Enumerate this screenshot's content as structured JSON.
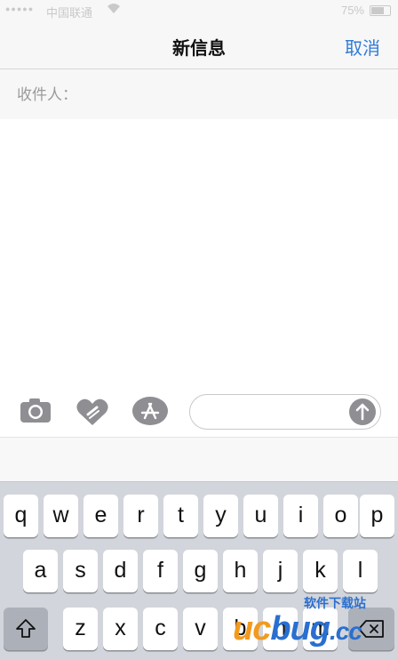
{
  "status_bar": {
    "signal_dots": "●●●●●",
    "carrier": "中国联通",
    "time": "",
    "battery_label": "75%"
  },
  "nav": {
    "title": "新信息",
    "cancel": "取消"
  },
  "recipient": {
    "label": "收件人："
  },
  "compose": {
    "input_placeholder": "",
    "icons": [
      "camera-icon",
      "heart-sketch-icon",
      "app-store-icon",
      "send-arrow-icon"
    ]
  },
  "keyboard": {
    "row1": [
      "q",
      "w",
      "e",
      "r",
      "t",
      "y",
      "u",
      "i",
      "o",
      "p"
    ],
    "row2": [
      "a",
      "s",
      "d",
      "f",
      "g",
      "h",
      "j",
      "k",
      "l"
    ],
    "row3": [
      "z",
      "x",
      "c",
      "v",
      "b",
      "n",
      "m"
    ],
    "shift_icon": "shift-icon",
    "delete_icon": "delete-icon"
  },
  "watermark": {
    "brand": "ucbug.cc",
    "tagline": "软件下载站"
  },
  "colors": {
    "accent": "#2f7ad6",
    "keyboard_bg": "#d2d5db",
    "send_button": "#8e8e93",
    "watermark_orange": "#f39a1d",
    "watermark_blue": "#2a6fcf"
  }
}
